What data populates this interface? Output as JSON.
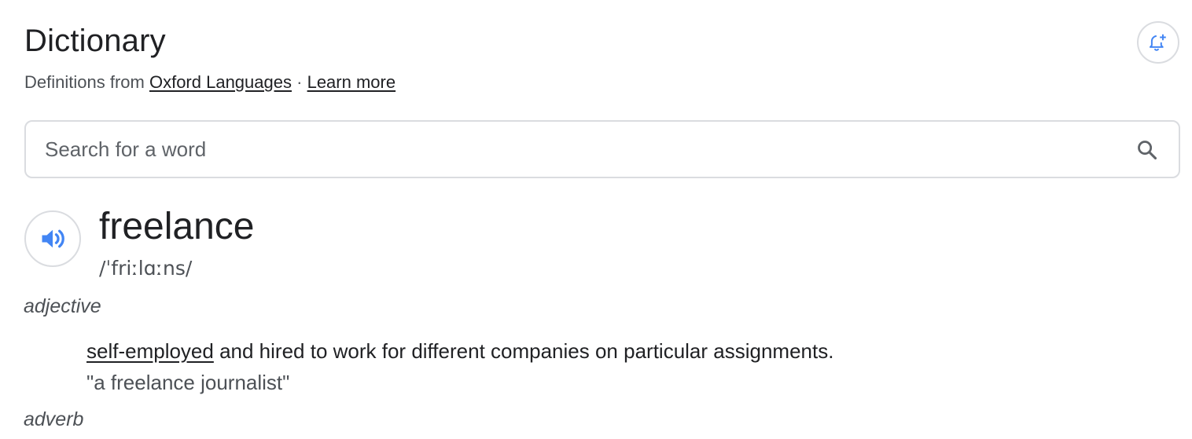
{
  "header": {
    "title": "Dictionary",
    "definitions_from": "Definitions from",
    "source_link": "Oxford Languages",
    "separator": "·",
    "learn_more": "Learn more"
  },
  "notify_button": {
    "icon": "bell-plus-icon"
  },
  "search": {
    "placeholder": "Search for a word",
    "value": "",
    "icon": "search-icon"
  },
  "entry": {
    "word": "freelance",
    "phonetic": "/ˈfriːlɑːns/",
    "pronounce_icon": "speaker-icon",
    "senses": [
      {
        "part_of_speech": "adjective",
        "definition_link": "self-employed",
        "definition_rest": " and hired to work for different companies on particular assignments.",
        "example": "\"a freelance journalist\""
      },
      {
        "part_of_speech": "adverb"
      }
    ]
  },
  "colors": {
    "accent": "#4285f4",
    "border": "#dadce0",
    "text_primary": "#202124",
    "text_secondary": "#4d5156"
  }
}
